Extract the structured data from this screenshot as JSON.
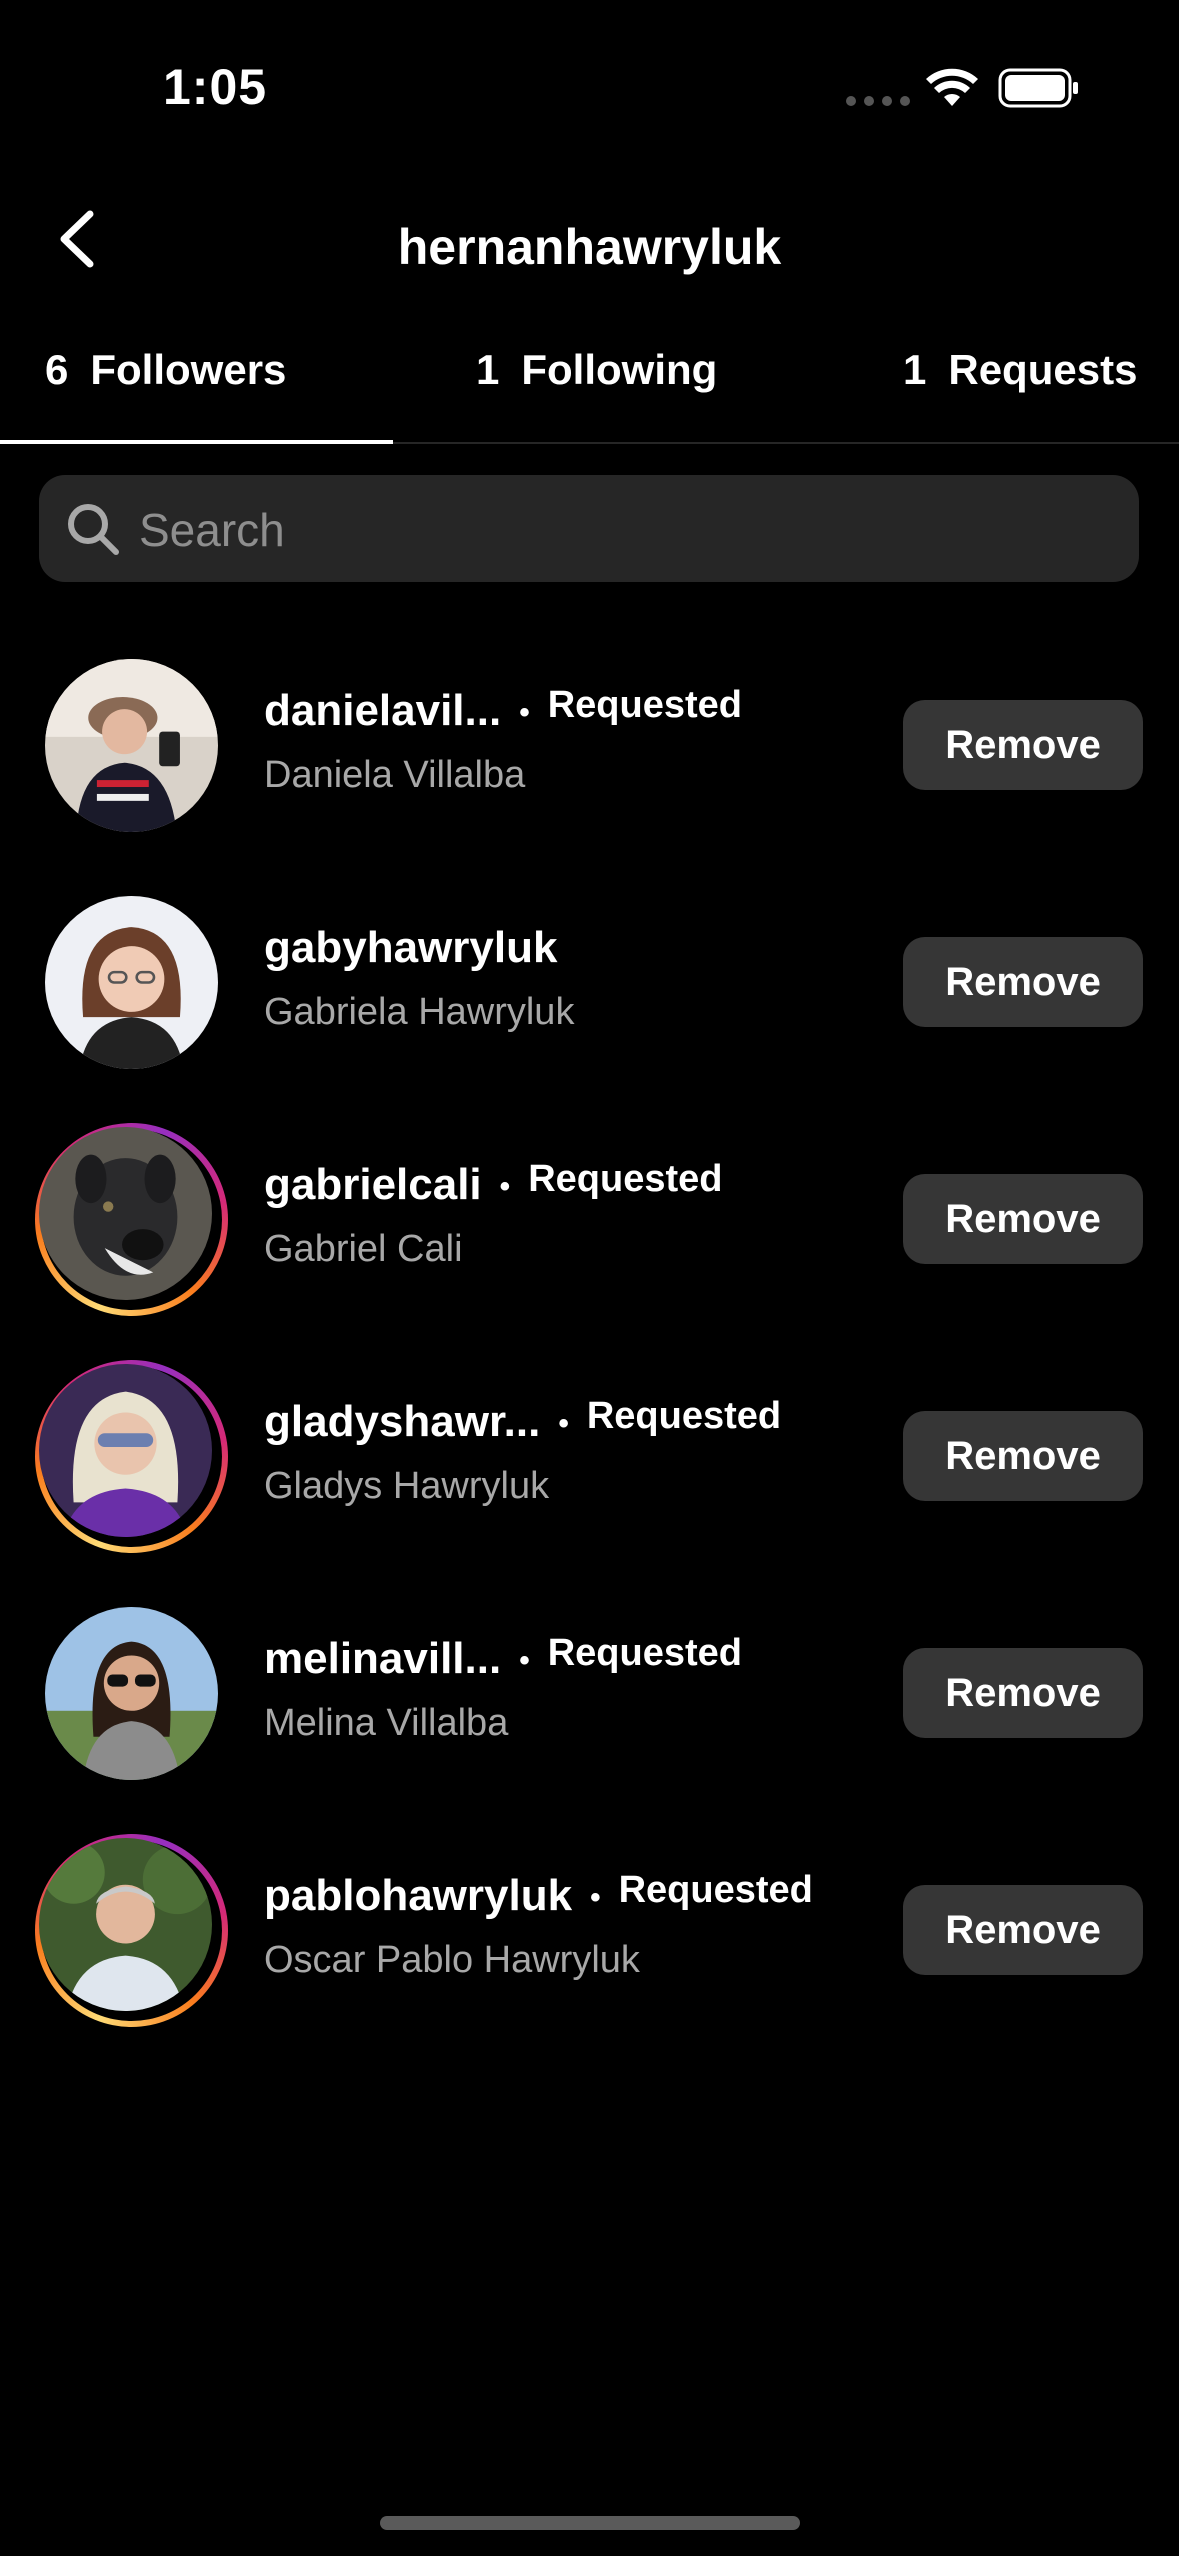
{
  "status_bar": {
    "time": "1:05"
  },
  "header": {
    "title": "hernanhawryluk"
  },
  "tabs": [
    {
      "count": "6",
      "label": "Followers"
    },
    {
      "count": "1",
      "label": "Following"
    },
    {
      "count": "1",
      "label": "Requests"
    }
  ],
  "search": {
    "placeholder": "Search"
  },
  "followers": [
    {
      "username": "danielavil...",
      "full_name": "Daniela Villalba",
      "dot": "•",
      "status": "Requested",
      "action": "Remove"
    },
    {
      "username": "gabyhawryluk",
      "full_name": "Gabriela Hawryluk",
      "dot": "",
      "status": "",
      "action": "Remove"
    },
    {
      "username": "gabrielcali",
      "full_name": "Gabriel Cali",
      "dot": "•",
      "status": "Requested",
      "action": "Remove"
    },
    {
      "username": "gladyshawr...",
      "full_name": "Gladys Hawryluk",
      "dot": "•",
      "status": "Requested",
      "action": "Remove"
    },
    {
      "username": "melinavill...",
      "full_name": "Melina Villalba",
      "dot": "•",
      "status": "Requested",
      "action": "Remove"
    },
    {
      "username": "pablohawryluk",
      "full_name": "Oscar Pablo Hawryluk",
      "dot": "•",
      "status": "Requested",
      "action": "Remove"
    }
  ]
}
